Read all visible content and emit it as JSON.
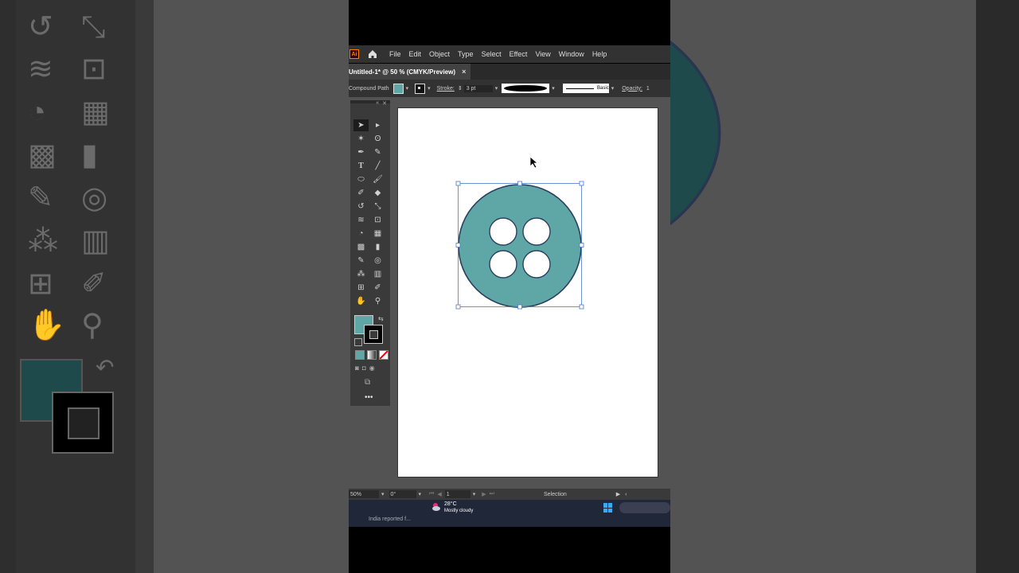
{
  "app": {
    "logo": "Ai"
  },
  "menu": [
    "File",
    "Edit",
    "Object",
    "Type",
    "Select",
    "Effect",
    "View",
    "Window",
    "Help"
  ],
  "tab": {
    "title": "Untitled-1* @ 50 % (CMYK/Preview)",
    "close": "×"
  },
  "control_bar": {
    "object_type": "Compound Path",
    "stroke_label": "Stroke:",
    "stroke_weight": "3 pt",
    "profile_label": "Basic",
    "opacity_label": "Opacity:",
    "opacity_value": "1"
  },
  "colors": {
    "fill": "#5fa6a6",
    "stroke": "#000000",
    "shape_outline": "#2a4060",
    "selection": "#4a78c8"
  },
  "status_bar": {
    "zoom": "50%",
    "rotation": "0°",
    "artboard": "1",
    "tool": "Selection"
  },
  "taskbar": {
    "temp": "28°C",
    "condition": "Mostly cloudy",
    "news": "India reported f..."
  },
  "icons": [
    "home-icon",
    "selection-tool-icon",
    "direct-selection-tool-icon",
    "magic-wand-icon",
    "lasso-icon",
    "pen-icon",
    "curvature-icon",
    "type-icon",
    "line-icon",
    "ellipse-icon",
    "paintbrush-icon",
    "shaper-icon",
    "eraser-icon",
    "rotate-icon",
    "scale-icon",
    "width-icon",
    "free-transform-icon",
    "shape-builder-icon",
    "perspective-icon",
    "mesh-icon",
    "gradient-icon",
    "eyedropper-icon",
    "blend-icon",
    "symbol-sprayer-icon",
    "graph-icon",
    "artboard-icon",
    "slice-icon",
    "hand-icon",
    "zoom-icon"
  ]
}
